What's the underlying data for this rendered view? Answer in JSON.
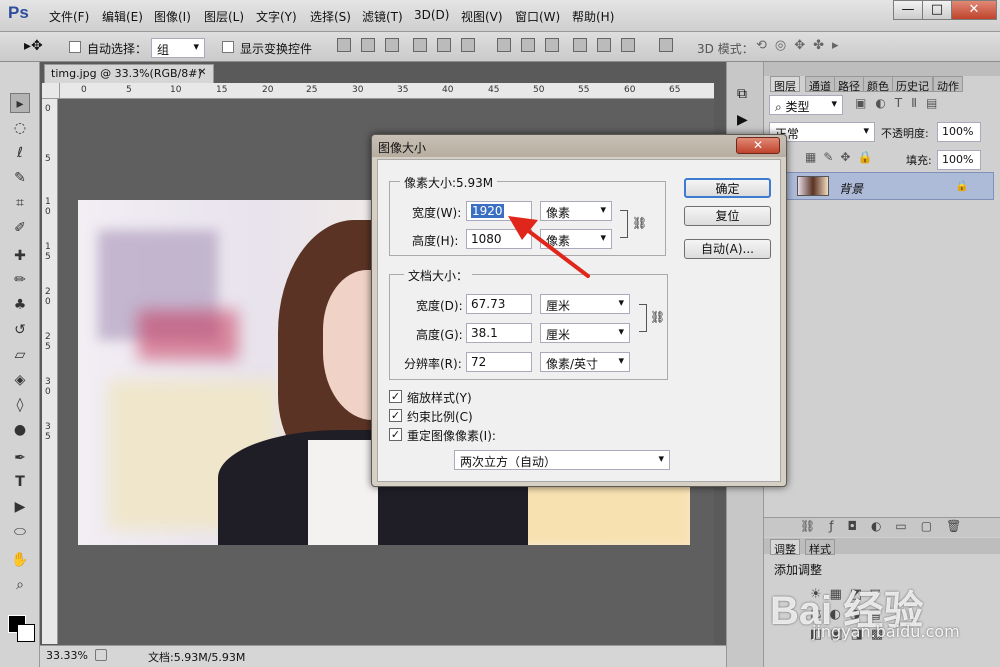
{
  "app": {
    "logo": "Ps"
  },
  "menu": [
    "文件(F)",
    "编辑(E)",
    "图像(I)",
    "图层(L)",
    "文字(Y)",
    "选择(S)",
    "滤镜(T)",
    "3D(D)",
    "视图(V)",
    "窗口(W)",
    "帮助(H)"
  ],
  "window_controls": {
    "minimize": "—",
    "maximize": "□",
    "close": "✕"
  },
  "options": {
    "auto_select": "自动选择：",
    "group": "组",
    "show_transform": "显示变换控件",
    "mode3d": "3D 模式："
  },
  "document": {
    "tab": "timg.jpg @ 33.3%(RGB/8#)",
    "tab_close": "✕",
    "zoom": "33.33%",
    "doc_info": "文档:5.93M/5.93M"
  },
  "ruler": {
    "top": [
      "0",
      "5",
      "10",
      "15",
      "20",
      "25",
      "30",
      "35",
      "40",
      "45",
      "50",
      "55",
      "60",
      "65"
    ],
    "left": [
      "0",
      "5",
      "1",
      "0",
      "1",
      "5",
      "2",
      "0",
      "2",
      "5",
      "3",
      "0",
      "3",
      "5"
    ]
  },
  "panel": {
    "tabs": [
      "图层",
      "通道",
      "路径",
      "颜色",
      "历史记",
      "动作"
    ],
    "filter": "类型",
    "blend": "正常",
    "opacity_label": "不透明度:",
    "opacity": "100%",
    "lock_label": "定:",
    "fill_label": "填充:",
    "fill": "100%",
    "layer_name": "背景",
    "adj_tabs": [
      "调整",
      "样式"
    ],
    "adj_title": "添加调整"
  },
  "dialog": {
    "title": "图像大小",
    "close": "✕",
    "pixel_group": "像素大小:5.93M",
    "width_label": "宽度(W):",
    "width": "1920",
    "width_unit": "像素",
    "height_label": "高度(H):",
    "height": "1080",
    "height_unit": "像素",
    "doc_group": "文档大小：",
    "doc_width_label": "宽度(D):",
    "doc_width": "67.73",
    "doc_width_unit": "厘米",
    "doc_height_label": "高度(G):",
    "doc_height": "38.1",
    "doc_height_unit": "厘米",
    "resolution_label": "分辨率(R):",
    "resolution": "72",
    "resolution_unit": "像素/英寸",
    "scale_styles": "缩放样式(Y)",
    "constrain": "约束比例(C)",
    "resample": "重定图像像素(I):",
    "resample_method": "两次立方（自动）",
    "ok": "确定",
    "reset": "复位",
    "auto": "自动(A)..."
  },
  "watermark": {
    "text": "Bai 经验",
    "url": "jingyan.baidu.com"
  }
}
